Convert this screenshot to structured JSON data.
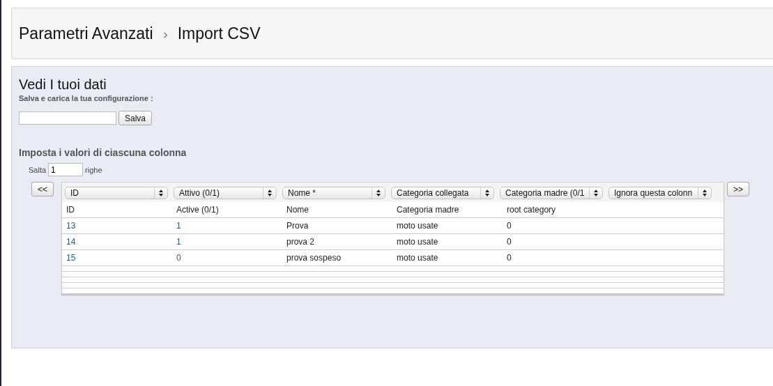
{
  "breadcrumb": [
    "Parametri Avanzati",
    "Import CSV"
  ],
  "section": {
    "title": "Vedi I tuoi dati",
    "subtitle": "Salva e carica la tua configurazione :",
    "save_button": "Salva"
  },
  "columns_title": "Imposta i valori di ciascuna colonna",
  "skip": {
    "before": "Salta",
    "value": "1",
    "after": "righe"
  },
  "prev_button": "<<",
  "next_button": ">>",
  "column_selects": [
    "ID",
    "Attivo (0/1)",
    "Nome *",
    "Categoria collegata",
    "Categoria madre (0/1",
    "Ignora questa colonn"
  ],
  "rows": [
    {
      "cells": [
        "ID",
        "Active (0/1)",
        "Nome",
        "Categoria madre",
        "root category"
      ]
    },
    {
      "cells": [
        "13",
        "1",
        "Prova",
        "moto usate",
        "0"
      ]
    },
    {
      "cells": [
        "14",
        "1",
        "prova 2",
        "moto usate",
        "0"
      ]
    },
    {
      "cells": [
        "15",
        "0",
        "prova sospeso",
        "moto usate",
        "0"
      ]
    }
  ]
}
